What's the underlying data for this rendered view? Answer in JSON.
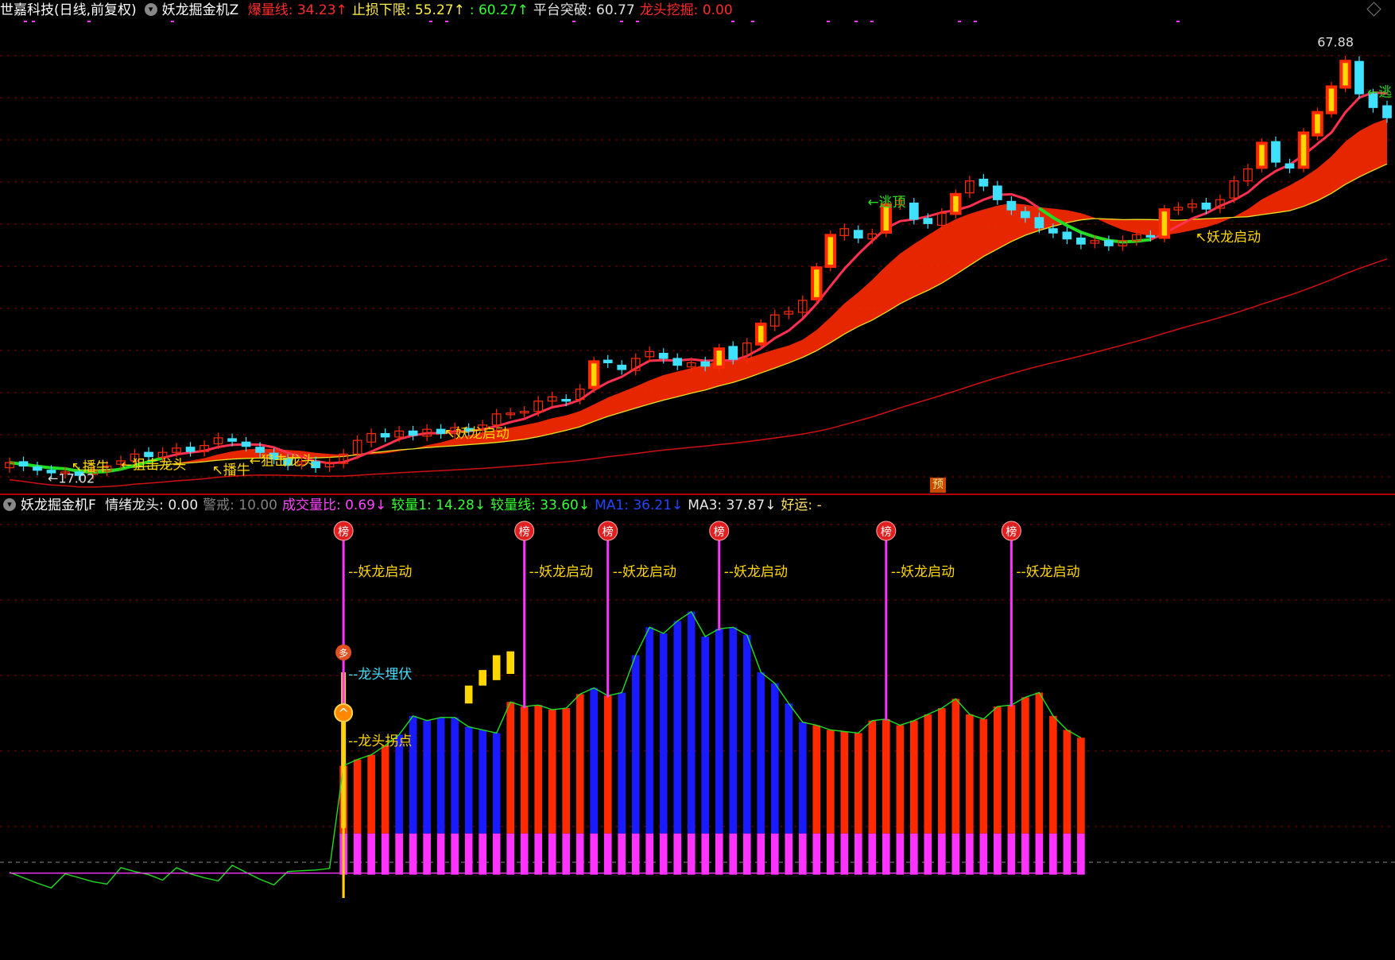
{
  "colors": {
    "bg": "#000000",
    "up": "#ff2a00",
    "down": "#40e0ff",
    "yellow": "#ffd700",
    "magenta": "#ff33ff",
    "green": "#22dd22",
    "blue": "#1a1aff",
    "grid": "#8a0000"
  },
  "top_panel": {
    "title": "世嘉科技(日线,前复权)",
    "indicator": "妖龙掘金机Z",
    "fields": [
      {
        "label": "爆量线: ",
        "value": "34.23",
        "arrow": "↑",
        "color": "#ff2a2a"
      },
      {
        "label": "止损下限: ",
        "value": "55.27",
        "arrow": "↑",
        "color": "#ffee44"
      },
      {
        "label": ": ",
        "value": "60.27",
        "arrow": "↑",
        "color": "#33ff33"
      },
      {
        "label": "平台突破: ",
        "value": "60.77",
        "arrow": "",
        "color": "#e0e0e0"
      },
      {
        "label": "龙头挖掘: ",
        "value": "0.00",
        "arrow": "",
        "color": "#ff2a2a"
      }
    ],
    "high_label": "67.88",
    "low_label": "17.02",
    "annotations": [
      "妖龙启动",
      "妖龙启动",
      "逃顶",
      "逃",
      "狙击龙头",
      "狙击龙头",
      "播牛",
      "播牛"
    ],
    "forecast_tag": "预"
  },
  "bottom_panel": {
    "title": "妖龙掘金机F",
    "fields": [
      {
        "label": "情绪龙头: ",
        "value": "0.00",
        "arrow": "",
        "color": "#e8e8e8"
      },
      {
        "label": "警戒: ",
        "value": "10.00",
        "arrow": "",
        "color": "#808080"
      },
      {
        "label": "成交量比: ",
        "value": "0.69",
        "arrow": "↓",
        "color": "#ff44ff"
      },
      {
        "label": "较量1: ",
        "value": "14.28",
        "arrow": "↓",
        "color": "#33ff33"
      },
      {
        "label": "较量线: ",
        "value": "33.60",
        "arrow": "↓",
        "color": "#33ff33"
      },
      {
        "label": "MA1: ",
        "value": "36.21",
        "arrow": "↓",
        "color": "#2244ff"
      },
      {
        "label": "MA3: ",
        "value": "37.87",
        "arrow": "↓",
        "color": "#e8e8e8"
      },
      {
        "label": "好运: ",
        "value": "-",
        "arrow": "",
        "color": "#ffe066"
      }
    ],
    "marker_label": "榜",
    "signal_label": "妖龙启动",
    "duo_label": "多",
    "ambush_label": "龙头埋伏",
    "turn_label": "龙头拐点"
  },
  "chart_data": {
    "type": "candlestick",
    "title": "世嘉科技(日线,前复权)",
    "candles": [
      {
        "o": 18.0,
        "c": 18.6
      },
      {
        "o": 18.7,
        "c": 18.2
      },
      {
        "o": 18.1,
        "c": 17.7
      },
      {
        "o": 17.7,
        "c": 17.4
      },
      {
        "o": 17.3,
        "c": 17.5
      },
      {
        "o": 17.5,
        "c": 17.1
      },
      {
        "o": 17.2,
        "c": 17.6
      },
      {
        "o": 17.6,
        "c": 18.2
      },
      {
        "o": 18.4,
        "c": 18.8
      },
      {
        "o": 18.8,
        "c": 19.6
      },
      {
        "o": 19.8,
        "c": 19.3
      },
      {
        "o": 19.2,
        "c": 19.8
      },
      {
        "o": 19.8,
        "c": 20.3
      },
      {
        "o": 20.4,
        "c": 19.9
      },
      {
        "o": 19.9,
        "c": 20.6
      },
      {
        "o": 20.8,
        "c": 21.5
      },
      {
        "o": 21.4,
        "c": 21.1
      },
      {
        "o": 21.0,
        "c": 20.5
      },
      {
        "o": 20.4,
        "c": 19.8
      },
      {
        "o": 19.7,
        "c": 19.0
      },
      {
        "o": 19.0,
        "c": 18.3
      },
      {
        "o": 18.4,
        "c": 18.7
      },
      {
        "o": 18.7,
        "c": 18.0
      },
      {
        "o": 18.1,
        "c": 18.6
      },
      {
        "o": 18.5,
        "c": 19.6
      },
      {
        "o": 19.6,
        "c": 21.2
      },
      {
        "o": 21.0,
        "c": 22.0
      },
      {
        "o": 22.0,
        "c": 21.6
      },
      {
        "o": 21.6,
        "c": 22.3
      },
      {
        "o": 22.3,
        "c": 21.8
      },
      {
        "o": 21.7,
        "c": 22.5
      },
      {
        "o": 22.5,
        "c": 22.0
      },
      {
        "o": 22.0,
        "c": 22.7
      },
      {
        "o": 22.6,
        "c": 22.3
      },
      {
        "o": 22.4,
        "c": 23.0
      },
      {
        "o": 23.0,
        "c": 24.3
      },
      {
        "o": 24.3,
        "c": 24.4
      },
      {
        "o": 24.5,
        "c": 24.6
      },
      {
        "o": 24.6,
        "c": 25.8
      },
      {
        "o": 25.8,
        "c": 26.3
      },
      {
        "o": 26.0,
        "c": 25.8
      },
      {
        "o": 26.0,
        "c": 27.2
      },
      {
        "o": 27.4,
        "c": 30.4
      },
      {
        "o": 30.6,
        "c": 30.3
      },
      {
        "o": 30.0,
        "c": 29.5
      },
      {
        "o": 29.4,
        "c": 30.8
      },
      {
        "o": 31.0,
        "c": 31.6
      },
      {
        "o": 31.4,
        "c": 30.8
      },
      {
        "o": 30.8,
        "c": 30.0
      },
      {
        "o": 29.8,
        "c": 30.3
      },
      {
        "o": 30.4,
        "c": 29.9
      },
      {
        "o": 29.8,
        "c": 31.9
      },
      {
        "o": 32.2,
        "c": 30.7
      },
      {
        "o": 30.8,
        "c": 32.6
      },
      {
        "o": 32.5,
        "c": 34.8
      },
      {
        "o": 34.6,
        "c": 35.9
      },
      {
        "o": 36.0,
        "c": 36.3
      },
      {
        "o": 36.2,
        "c": 37.6
      },
      {
        "o": 37.8,
        "c": 41.4
      },
      {
        "o": 41.6,
        "c": 45.2
      },
      {
        "o": 45.2,
        "c": 46.0
      },
      {
        "o": 45.8,
        "c": 44.9
      },
      {
        "o": 44.8,
        "c": 45.4
      },
      {
        "o": 45.6,
        "c": 48.8
      },
      {
        "o": 48.8,
        "c": 49.3
      },
      {
        "o": 49.0,
        "c": 47.1
      },
      {
        "o": 47.2,
        "c": 46.6
      },
      {
        "o": 46.4,
        "c": 47.8
      },
      {
        "o": 47.8,
        "c": 50.0
      },
      {
        "o": 50.2,
        "c": 51.6
      },
      {
        "o": 51.8,
        "c": 51.0
      },
      {
        "o": 51.0,
        "c": 49.4
      },
      {
        "o": 49.2,
        "c": 48.2
      },
      {
        "o": 48.0,
        "c": 47.3
      },
      {
        "o": 47.3,
        "c": 46.1
      },
      {
        "o": 46.0,
        "c": 45.5
      },
      {
        "o": 45.6,
        "c": 44.8
      },
      {
        "o": 44.9,
        "c": 44.2
      },
      {
        "o": 44.3,
        "c": 44.6
      },
      {
        "o": 44.6,
        "c": 44.0
      },
      {
        "o": 44.0,
        "c": 44.6
      },
      {
        "o": 44.6,
        "c": 45.3
      },
      {
        "o": 45.2,
        "c": 45.1
      },
      {
        "o": 45.0,
        "c": 48.2
      },
      {
        "o": 48.2,
        "c": 48.5
      },
      {
        "o": 48.5,
        "c": 48.9
      },
      {
        "o": 49.0,
        "c": 48.3
      },
      {
        "o": 48.4,
        "c": 49.4
      },
      {
        "o": 49.6,
        "c": 51.6
      },
      {
        "o": 51.6,
        "c": 53.0
      },
      {
        "o": 53.2,
        "c": 56.0
      },
      {
        "o": 56.2,
        "c": 53.8
      },
      {
        "o": 53.6,
        "c": 53.1
      },
      {
        "o": 53.2,
        "c": 57.2
      },
      {
        "o": 57.0,
        "c": 59.6
      },
      {
        "o": 59.6,
        "c": 62.6
      },
      {
        "o": 62.6,
        "c": 65.6
      },
      {
        "o": 65.6,
        "c": 61.8
      },
      {
        "o": 61.8,
        "c": 60.2
      },
      {
        "o": 60.4,
        "c": 59.0
      }
    ],
    "y_range": [
      16,
      70
    ],
    "volume": [
      0.3,
      0.2,
      0.1,
      0.1,
      0.1,
      0.2,
      0.3,
      0.6,
      0.9,
      1.0,
      1.2,
      1.1,
      0.9,
      0.7,
      0.8,
      1.0,
      1.2,
      0.9,
      0.6,
      0.5,
      0.4,
      0.5,
      0.6,
      0.8,
      14.0,
      14.8,
      15.4,
      16.6,
      18.0,
      20.4,
      19.8,
      20.2,
      20.2,
      19.0,
      18.6,
      18.2,
      22.2,
      21.6,
      21.8,
      21.2,
      21.4,
      23.2,
      24.0,
      23.0,
      23.4,
      28.2,
      31.8,
      31.0,
      32.6,
      33.8,
      30.6,
      31.6,
      31.8,
      30.8,
      26.0,
      24.6,
      22.0,
      19.6,
      19.2,
      18.6,
      18.4,
      18.2,
      19.8,
      20.0,
      19.2,
      19.8,
      20.6,
      21.4,
      22.6,
      20.6,
      20.0,
      21.6,
      21.8,
      22.8,
      23.4,
      20.4,
      18.6,
      17.6
    ],
    "volume_range": [
      -3,
      45
    ]
  }
}
